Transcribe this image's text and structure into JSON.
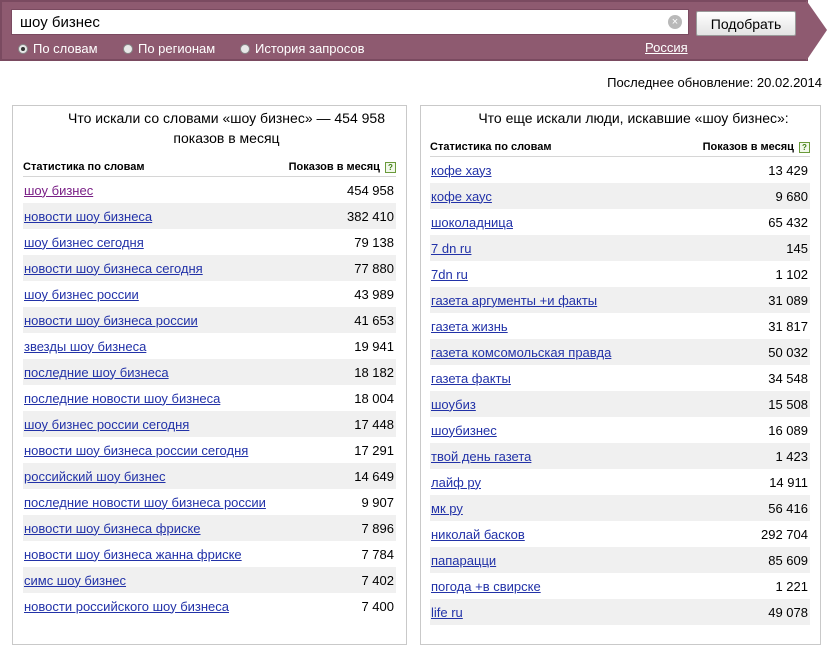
{
  "search": {
    "query": "шоу бизнес",
    "clear_symbol": "×",
    "submit_label": "Подобрать"
  },
  "modes": [
    {
      "label": "По словам",
      "checked": true
    },
    {
      "label": "По регионам",
      "checked": false
    },
    {
      "label": "История запросов",
      "checked": false
    }
  ],
  "region": "Россия",
  "updated": "Последнее обновление: 20.02.2014",
  "colors": {
    "band": "#8e5a70",
    "link": "#2232a8",
    "visited_link": "#7a1f86",
    "row_alt": "#f0f0f0"
  },
  "left": {
    "title": "Что искали со словами «шоу бизнес» — 454 958 показов в месяц",
    "col_words": "Статистика по словам",
    "col_count": "Показов в месяц",
    "help_symbol": "?",
    "rows": [
      {
        "phrase": "шоу бизнес",
        "count": "454 958"
      },
      {
        "phrase": "новости шоу бизнеса",
        "count": "382 410"
      },
      {
        "phrase": "шоу бизнес сегодня",
        "count": "79 138"
      },
      {
        "phrase": "новости шоу бизнеса сегодня",
        "count": "77 880"
      },
      {
        "phrase": "шоу бизнес россии",
        "count": "43 989"
      },
      {
        "phrase": "новости шоу бизнеса россии",
        "count": "41 653"
      },
      {
        "phrase": "звезды шоу бизнеса",
        "count": "19 941"
      },
      {
        "phrase": "последние шоу бизнеса",
        "count": "18 182"
      },
      {
        "phrase": "последние новости шоу бизнеса",
        "count": "18 004"
      },
      {
        "phrase": "шоу бизнес россии сегодня",
        "count": "17 448"
      },
      {
        "phrase": "новости шоу бизнеса россии сегодня",
        "count": "17 291"
      },
      {
        "phrase": "российский шоу бизнес",
        "count": "14 649"
      },
      {
        "phrase": "последние новости шоу бизнеса россии",
        "count": "9 907"
      },
      {
        "phrase": "новости шоу бизнеса фриске",
        "count": "7 896"
      },
      {
        "phrase": "новости шоу бизнеса жанна фриске",
        "count": "7 784"
      },
      {
        "phrase": "симс шоу бизнес",
        "count": "7 402"
      },
      {
        "phrase": "новости российского шоу бизнеса",
        "count": "7 400"
      }
    ]
  },
  "right": {
    "title": "Что еще искали люди, искавшие «шоу бизнес»:",
    "col_words": "Статистика по словам",
    "col_count": "Показов в месяц",
    "help_symbol": "?",
    "rows": [
      {
        "phrase": "кофе хауз",
        "count": "13 429"
      },
      {
        "phrase": "кофе хаус",
        "count": "9 680"
      },
      {
        "phrase": "шоколадница",
        "count": "65 432"
      },
      {
        "phrase": "7 dn ru",
        "count": "145"
      },
      {
        "phrase": "7dn ru",
        "count": "1 102"
      },
      {
        "phrase": "газета аргументы +и факты",
        "count": "31 089"
      },
      {
        "phrase": "газета жизнь",
        "count": "31 817"
      },
      {
        "phrase": "газета комсомольская правда",
        "count": "50 032"
      },
      {
        "phrase": "газета факты",
        "count": "34 548"
      },
      {
        "phrase": "шоубиз",
        "count": "15 508"
      },
      {
        "phrase": "шоубизнес",
        "count": "16 089"
      },
      {
        "phrase": "твой день газета",
        "count": "1 423"
      },
      {
        "phrase": "лайф ру",
        "count": "14 911"
      },
      {
        "phrase": "мк ру",
        "count": "56 416"
      },
      {
        "phrase": "николай басков",
        "count": "292 704"
      },
      {
        "phrase": "папарацци",
        "count": "85 609"
      },
      {
        "phrase": "погода +в свирске",
        "count": "1 221"
      },
      {
        "phrase": "life ru",
        "count": "49 078"
      }
    ]
  }
}
